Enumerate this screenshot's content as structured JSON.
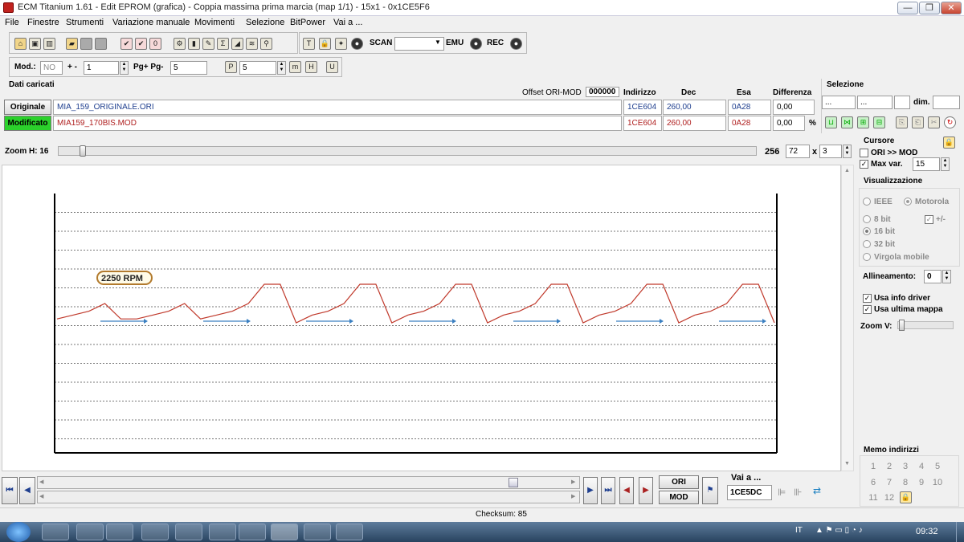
{
  "window": {
    "title": "ECM Titanium 1.61 - Edit EPROM (grafica) - Coppia massima prima marcia (map 1/1) - 15x1 - 0x1CE5F6",
    "min_label": "—",
    "max_label": "❐",
    "close_label": "✕"
  },
  "menu": [
    "File",
    "Finestre",
    "Strumenti",
    "Variazione manuale",
    "Movimenti",
    "Selezione",
    "BitPower",
    "Vai a ..."
  ],
  "toolbar": {
    "scan_label": "SCAN",
    "emu_label": "EMU",
    "rec_label": "REC",
    "scan_value": ""
  },
  "toolbar2": {
    "mod_label": "Mod.:",
    "mod_value": "NO",
    "plusminus_label": "+ -",
    "plusminus_value": "1",
    "pg_label": "Pg+ Pg-",
    "pg_value": "5",
    "p_value": "5",
    "p_icon": "P",
    "m_icon": "m",
    "h_icon": "H",
    "u_icon": "U"
  },
  "data_panel": {
    "title": "Dati caricati",
    "offset_label": "Offset ORI-MOD",
    "offset_value": "000000",
    "col_indirizzo": "Indirizzo",
    "col_dec": "Dec",
    "col_esa": "Esa",
    "col_diff": "Differenza",
    "percent": "%",
    "original": {
      "label": "Originale",
      "file": "MIA_159_ORIGINALE.ORI",
      "addr": "1CE604",
      "dec": "260,00",
      "hex": "0A28",
      "diff": "0,00"
    },
    "modified": {
      "label": "Modificato",
      "file": "MIA159_170BIS.MOD",
      "addr": "1CE604",
      "dec": "260,00",
      "hex": "0A28",
      "diff": "0,00"
    }
  },
  "selection": {
    "title": "Selezione",
    "f1": "...",
    "f2": "...",
    "f3": "",
    "dim_label": "dim.",
    "dim_value": ""
  },
  "zoom": {
    "label": "Zoom H: 16",
    "max": "256",
    "w_value": "72",
    "x_label": "x",
    "h_value": "3",
    "fraction": 0.03
  },
  "chart_data": {
    "type": "line",
    "annotation": "2250 RPM",
    "gridlines": true,
    "series": [
      {
        "color": "#c0392b",
        "values": [
          1,
          2,
          3,
          5,
          1,
          1,
          2,
          3,
          5,
          1,
          2,
          3,
          5,
          10,
          10,
          0,
          2,
          3,
          5,
          10,
          10,
          0,
          2,
          3,
          5,
          10,
          10,
          0,
          2,
          3,
          5,
          10,
          10,
          0,
          2,
          3,
          5,
          10,
          10,
          0,
          2,
          3,
          5,
          10,
          10,
          0
        ]
      },
      {
        "color": "#3a7fc1",
        "values": []
      }
    ]
  },
  "cursor": {
    "title": "Cursore",
    "ori_mod": "ORI >> MOD",
    "max_var": "Max var.",
    "max_var_value": "15"
  },
  "visual": {
    "title": "Visualizzazione",
    "ieee": "IEEE",
    "motorola": "Motorola",
    "b8": "8 bit",
    "pm": "+/-",
    "b16": "16 bit",
    "b32": "32 bit",
    "float": "Virgola mobile",
    "align_label": "Allineamento:",
    "align_value": "0",
    "info_driver": "Usa info driver",
    "last_map": "Usa ultima mappa",
    "zoom_v": "Zoom V:"
  },
  "memo": {
    "title": "Memo indirizzi",
    "numbers": [
      "1",
      "2",
      "3",
      "4",
      "5",
      "6",
      "7",
      "8",
      "9",
      "10",
      "11",
      "12"
    ]
  },
  "bottom": {
    "ori_label": "ORI",
    "mod_label": "MOD",
    "goto_label": "Vai a ...",
    "goto_value": "1CE5DC",
    "checksum": "Checksum: 85"
  },
  "taskbar": {
    "lang": "IT",
    "time": "09:32"
  }
}
